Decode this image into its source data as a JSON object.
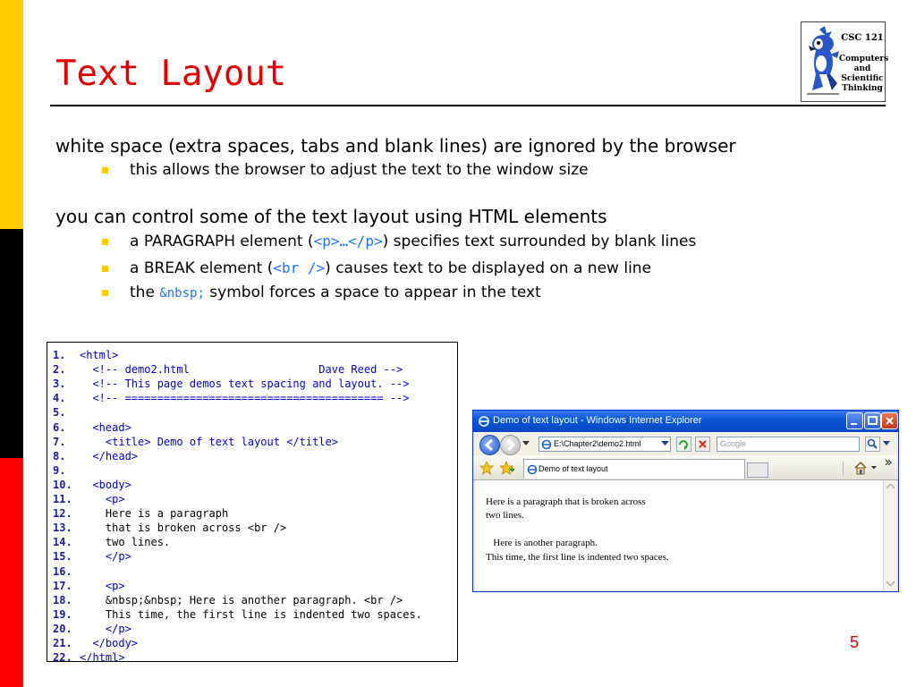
{
  "slide": {
    "title": "Text Layout",
    "page_number": "5"
  },
  "logo": {
    "lines": [
      "CSC 121",
      "Computers",
      "and",
      "Scientific",
      "Thinking"
    ]
  },
  "bullets": [
    {
      "text": "white space (extra spaces, tabs and blank lines) are ignored by the browser",
      "sub": [
        "this allows the browser to adjust the text to the window size"
      ]
    },
    {
      "text": "you can control some of the text layout using HTML elements",
      "sub": [
        {
          "pre": "a PARAGRAPH element (",
          "code": "<p>…</p>",
          "post": ") specifies text surrounded by blank lines"
        },
        {
          "pre": "a BREAK element (",
          "code": "<br />",
          "post": ") causes text to be displayed on a new line"
        },
        {
          "pre": "the ",
          "code": "&nbsp;",
          "post": " symbol forces a space to appear in the text"
        }
      ]
    }
  ],
  "listing": [
    {
      "n": "1.",
      "t": "<html>"
    },
    {
      "n": "2.",
      "t": "  <!-- demo2.html                    Dave Reed -->"
    },
    {
      "n": "3.",
      "t": "  <!-- This page demos text spacing and layout. -->"
    },
    {
      "n": "4.",
      "t": "  <!-- ======================================== -->"
    },
    {
      "n": "5.",
      "t": ""
    },
    {
      "n": "6.",
      "t": "  <head>"
    },
    {
      "n": "7.",
      "t": "    <title> Demo of text layout </title>"
    },
    {
      "n": "8.",
      "t": "  </head>"
    },
    {
      "n": "9.",
      "t": ""
    },
    {
      "n": "10.",
      "t": "  <body>"
    },
    {
      "n": "11.",
      "t": "    <p>"
    },
    {
      "n": "12.",
      "t": "    Here is a paragraph"
    },
    {
      "n": "13.",
      "t": "    that is broken across <br />"
    },
    {
      "n": "14.",
      "t": "    two lines."
    },
    {
      "n": "15.",
      "t": "    </p>"
    },
    {
      "n": "16.",
      "t": ""
    },
    {
      "n": "17.",
      "t": "    <p>"
    },
    {
      "n": "18.",
      "t": "    &nbsp;&nbsp; Here is another paragraph. <br />"
    },
    {
      "n": "19.",
      "t": "    This time, the first line is indented two spaces."
    },
    {
      "n": "20.",
      "t": "    </p>"
    },
    {
      "n": "21.",
      "t": "  </body>"
    },
    {
      "n": "22.",
      "t": "</html>"
    }
  ],
  "browser": {
    "window_title": "Demo of text layout - Windows Internet Explorer",
    "address": "E:\\Chapter2\\demo2.html",
    "search_placeholder": "Google",
    "tab_label": "Demo of text layout",
    "content_lines": [
      "Here is a paragraph that is broken across",
      "two lines.",
      "",
      "   Here is another paragraph.",
      "This time, the first line is indented two spaces."
    ]
  },
  "colors": {
    "title": "#e00000",
    "stripe_top": "#ffcc00",
    "stripe_mid": "#000000",
    "stripe_bottom": "#ff0000",
    "bullet": "#ffcc00",
    "code": "#1a73ff"
  }
}
